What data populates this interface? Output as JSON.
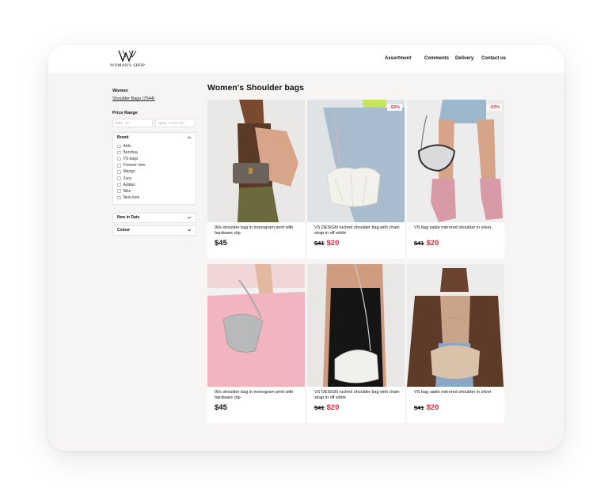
{
  "brand": {
    "name": "WOMAN'S SHOP"
  },
  "nav": {
    "assortment": "Assortment",
    "comments": "Comments",
    "delivery": "Delivery",
    "contact": "Contact us"
  },
  "sidebar": {
    "category": "Women",
    "subcategory_link": "Shoulder Bags (7544)",
    "price_range": {
      "title": "Price Range",
      "from_prefix": "from",
      "from_value": "10",
      "to_prefix": "up to",
      "to_value": "3 000 000"
    },
    "brand_filter": {
      "title": "Brand",
      "items": [
        "Aldo",
        "Bershka",
        "VS bags",
        "Forever new",
        "Mango",
        "Zara",
        "Adidas",
        "Nike",
        "New look"
      ]
    },
    "new_in_date": "New in Date",
    "colour": "Colour"
  },
  "page_title": "Women's Shoulder bags",
  "products": [
    {
      "title": "90s shoulder bag in monogram print with hardware clip",
      "old_price": "",
      "price": "$45",
      "badge": ""
    },
    {
      "title": "VS DESIGN ruched shoulder bag with chain strap in off white",
      "old_price": "$41",
      "price": "$20",
      "badge": "-53%"
    },
    {
      "title": "VS bag sadie mirrored shoulder in silver",
      "old_price": "$41",
      "price": "$20",
      "badge": "-53%"
    },
    {
      "title": "90s shoulder bag in monogram print with hardware clip",
      "old_price": "",
      "price": "$45",
      "badge": ""
    },
    {
      "title": "VS DESIGN ruched shoulder bag with chain strap in off white",
      "old_price": "$41",
      "price": "$20",
      "badge": ""
    },
    {
      "title": "VS bag sadie mirrored shoulder in silver",
      "old_price": "$41",
      "price": "$20",
      "badge": ""
    }
  ],
  "colors": {
    "sale_red": "#e02a3b",
    "page_bg": "#f6f5f3"
  }
}
